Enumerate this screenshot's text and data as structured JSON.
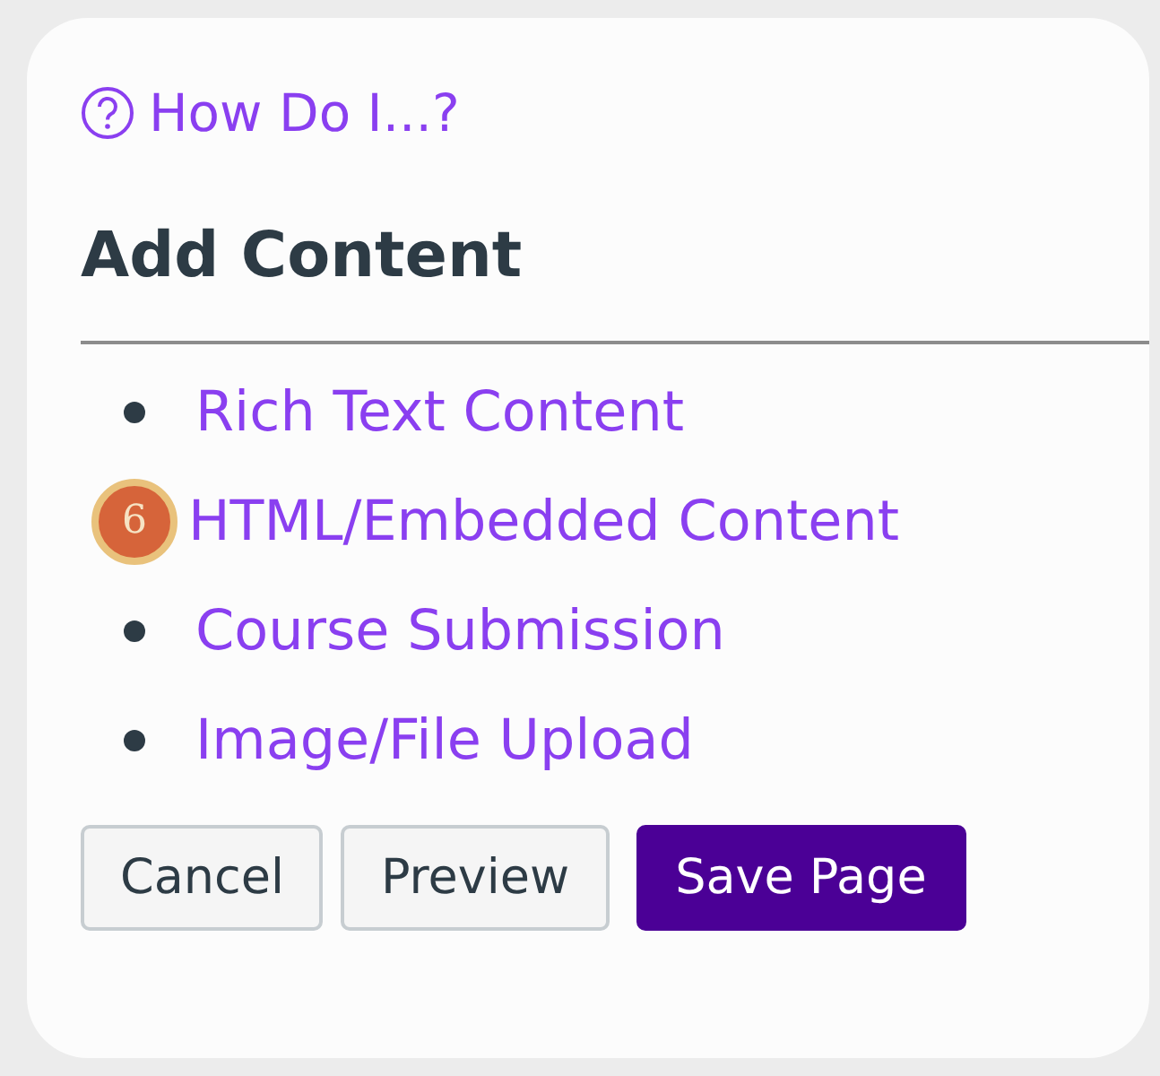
{
  "help_link": {
    "label": "How Do I...?"
  },
  "section": {
    "title": "Add Content"
  },
  "content_types": [
    {
      "label": "Rich Text Content"
    },
    {
      "label": "HTML/Embedded Content",
      "callout": "6"
    },
    {
      "label": "Course Submission"
    },
    {
      "label": "Image/File Upload"
    }
  ],
  "buttons": [
    {
      "label": "Cancel",
      "kind": "default"
    },
    {
      "label": "Preview",
      "kind": "default"
    },
    {
      "label": "Save Page",
      "kind": "primary"
    }
  ]
}
